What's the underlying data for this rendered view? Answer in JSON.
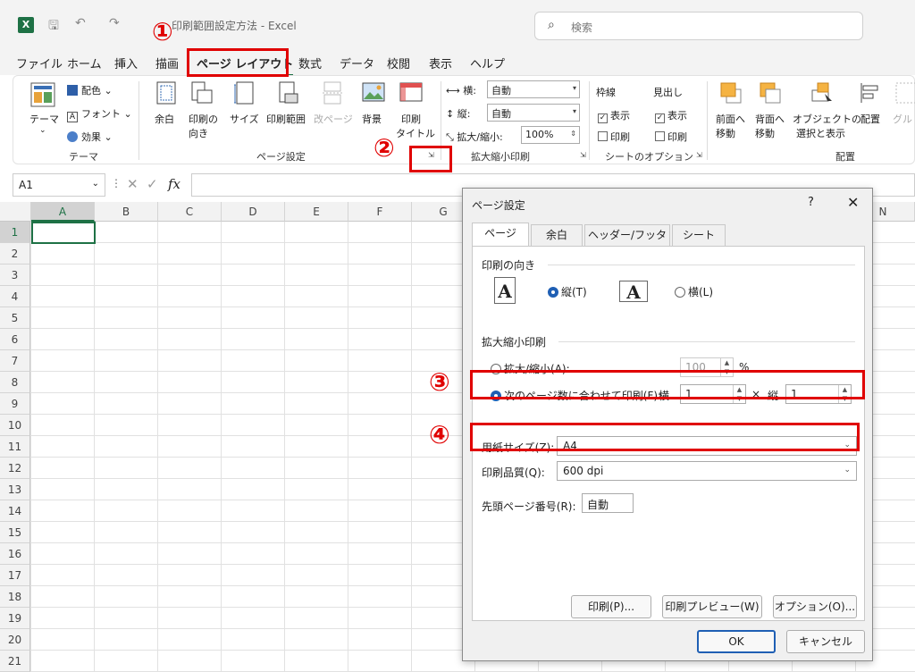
{
  "window": {
    "doc_title": "印刷範囲設定方法 - Excel",
    "search_placeholder": "検索"
  },
  "tabs": [
    "ファイル",
    "ホーム",
    "挿入",
    "描画",
    "ページ レイアウト",
    "数式",
    "データ",
    "校閲",
    "表示",
    "ヘルプ"
  ],
  "ribbon": {
    "theme": {
      "theme_btn": "テーマ",
      "colors": "配色",
      "fonts": "フォント",
      "effects": "効果",
      "group_label": "テーマ"
    },
    "page_setup": {
      "margins": "余白",
      "orientation_l1": "印刷の",
      "orientation_l2": "向き",
      "size": "サイズ",
      "print_area": "印刷範囲",
      "breaks": "改ページ",
      "background": "背景",
      "print_titles_l1": "印刷",
      "print_titles_l2": "タイトル",
      "group_label": "ページ設定"
    },
    "scale": {
      "width_label": "横:",
      "width_value": "自動",
      "height_label": "縦:",
      "height_value": "自動",
      "scale_label": "拡大/縮小:",
      "scale_value": "100%",
      "group_label": "拡大縮小印刷"
    },
    "sheet_options": {
      "gridlines": "枠線",
      "headings": "見出し",
      "view": "表示",
      "print": "印刷",
      "group_label": "シートのオプション"
    },
    "arrange": {
      "bring_forward_l1": "前面へ",
      "bring_forward_l2": "移動",
      "send_backward_l1": "背面へ",
      "send_backward_l2": "移動",
      "selection_pane_l1": "オブジェクトの",
      "selection_pane_l2": "選択と表示",
      "align": "配置",
      "group": "グル",
      "group_label": "配置"
    }
  },
  "formula_bar": {
    "name_box": "A1",
    "fx": "fx"
  },
  "grid": {
    "columns": [
      "A",
      "B",
      "C",
      "D",
      "E",
      "F",
      "G",
      "N"
    ],
    "rows": [
      "1",
      "2",
      "3",
      "4",
      "5",
      "6",
      "7",
      "8",
      "9",
      "10",
      "11",
      "12",
      "13",
      "14",
      "15",
      "16",
      "17",
      "18",
      "19",
      "20",
      "21"
    ]
  },
  "dialog": {
    "title": "ページ設定",
    "help": "?",
    "close": "✕",
    "tabs": [
      "ページ",
      "余白",
      "ヘッダー/フッター",
      "シート"
    ],
    "orientation_section": "印刷の向き",
    "portrait": "縦(T)",
    "landscape": "横(L)",
    "scaling_section": "拡大縮小印刷",
    "adjust_to": "拡大/縮小(A):",
    "adjust_value": "100",
    "percent": "%",
    "fit_to": "次のページ数に合わせて印刷(F):",
    "fit_wide_label": "横",
    "fit_wide_value": "1",
    "fit_x": "×",
    "fit_tall_label": "縦",
    "fit_tall_value": "1",
    "paper_size_label": "用紙サイズ(Z):",
    "paper_size_value": "A4",
    "print_quality_label": "印刷品質(Q):",
    "print_quality_value": "600 dpi",
    "first_page_label": "先頭ページ番号(R):",
    "first_page_value": "自動",
    "print_btn": "印刷(P)...",
    "preview_btn": "印刷プレビュー(W)",
    "options_btn": "オプション(O)...",
    "ok_btn": "OK",
    "cancel_btn": "キャンセル"
  },
  "annotations": [
    "①",
    "②",
    "③",
    "④"
  ],
  "colors": {
    "excel_green": "#1e7145",
    "annotation_red": "#e00000",
    "radio_blue": "#1f5fb4"
  }
}
